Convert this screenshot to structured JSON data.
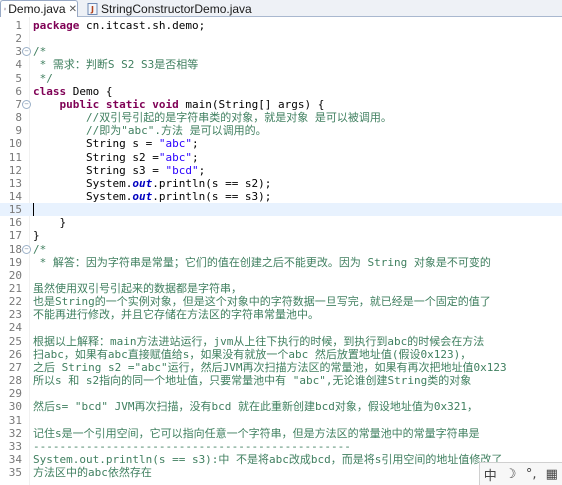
{
  "tabs": [
    {
      "label": "Demo.java",
      "active": true,
      "close": "✕"
    },
    {
      "label": "StringConstructorDemo.java",
      "active": false
    }
  ],
  "lines": [
    {
      "n": "1",
      "fold": false,
      "parts": [
        {
          "t": "package",
          "c": "kw"
        },
        {
          "t": " cn.itcast.sh.demo;",
          "c": ""
        }
      ]
    },
    {
      "n": "2",
      "fold": false,
      "parts": []
    },
    {
      "n": "3",
      "fold": true,
      "parts": [
        {
          "t": "/*",
          "c": "cm"
        }
      ]
    },
    {
      "n": "4",
      "fold": false,
      "parts": [
        {
          "t": " * 需求：判断S S2 S3是否相等",
          "c": "cm"
        }
      ]
    },
    {
      "n": "5",
      "fold": false,
      "parts": [
        {
          "t": " */",
          "c": "cm"
        }
      ]
    },
    {
      "n": "6",
      "fold": false,
      "parts": [
        {
          "t": "class",
          "c": "kw"
        },
        {
          "t": " Demo {",
          "c": ""
        }
      ]
    },
    {
      "n": "7",
      "fold": true,
      "parts": [
        {
          "t": "    ",
          "c": ""
        },
        {
          "t": "public static void",
          "c": "kw"
        },
        {
          "t": " main(String[] args) {",
          "c": ""
        }
      ]
    },
    {
      "n": "8",
      "fold": false,
      "parts": [
        {
          "t": "        //双引号引起的是字符串类的对象，就是对象 是可以被调用。",
          "c": "cm"
        }
      ]
    },
    {
      "n": "9",
      "fold": false,
      "parts": [
        {
          "t": "        //即为\"abc\".方法 是可以调用的。",
          "c": "cm"
        }
      ]
    },
    {
      "n": "10",
      "fold": false,
      "parts": [
        {
          "t": "        String s = ",
          "c": ""
        },
        {
          "t": "\"abc\"",
          "c": "str"
        },
        {
          "t": ";",
          "c": ""
        }
      ]
    },
    {
      "n": "11",
      "fold": false,
      "parts": [
        {
          "t": "        String s2 =",
          "c": ""
        },
        {
          "t": "\"abc\"",
          "c": "str"
        },
        {
          "t": ";",
          "c": ""
        }
      ]
    },
    {
      "n": "12",
      "fold": false,
      "parts": [
        {
          "t": "        String s3 = ",
          "c": ""
        },
        {
          "t": "\"bcd\"",
          "c": "str"
        },
        {
          "t": ";",
          "c": ""
        }
      ]
    },
    {
      "n": "13",
      "fold": false,
      "parts": [
        {
          "t": "        System.",
          "c": ""
        },
        {
          "t": "out",
          "c": "fld"
        },
        {
          "t": ".println(s == s2);",
          "c": ""
        }
      ]
    },
    {
      "n": "14",
      "fold": false,
      "parts": [
        {
          "t": "        System.",
          "c": ""
        },
        {
          "t": "out",
          "c": "fld"
        },
        {
          "t": ".println(s == s3);",
          "c": ""
        }
      ]
    },
    {
      "n": "15",
      "fold": false,
      "highlight": true,
      "parts": []
    },
    {
      "n": "16",
      "fold": false,
      "parts": [
        {
          "t": "    }",
          "c": ""
        }
      ]
    },
    {
      "n": "17",
      "fold": false,
      "parts": [
        {
          "t": "}",
          "c": ""
        }
      ]
    },
    {
      "n": "18",
      "fold": true,
      "parts": [
        {
          "t": "/*",
          "c": "cm"
        }
      ]
    },
    {
      "n": "19",
      "fold": false,
      "parts": [
        {
          "t": " * 解答：因为字符串是常量；它们的值在创建之后不能更改。因为 String 对象是不可变的",
          "c": "cm"
        }
      ]
    },
    {
      "n": "20",
      "fold": false,
      "parts": [
        {
          "t": "",
          "c": "cm"
        }
      ]
    },
    {
      "n": "21",
      "fold": false,
      "parts": [
        {
          "t": "虽然使用双引号引起来的数据都是字符串，",
          "c": "cm"
        }
      ]
    },
    {
      "n": "22",
      "fold": false,
      "parts": [
        {
          "t": "也是String的一个实例对象，但是这个对象中的字符数据一旦写完，就已经是一个固定的值了",
          "c": "cm"
        }
      ]
    },
    {
      "n": "23",
      "fold": false,
      "parts": [
        {
          "t": "不能再进行修改，并且它存储在方法区的字符串常量池中。",
          "c": "cm"
        }
      ]
    },
    {
      "n": "24",
      "fold": false,
      "parts": [
        {
          "t": "",
          "c": "cm"
        }
      ]
    },
    {
      "n": "25",
      "fold": false,
      "parts": [
        {
          "t": "根据以上解释：main方法进站运行，jvm从上往下执行的时候，到执行到abc的时候会在方法",
          "c": "cm"
        }
      ]
    },
    {
      "n": "26",
      "fold": false,
      "parts": [
        {
          "t": "扫abc，如果有abc直接赋值给s，如果没有就放一个abc 然后放置地址值(假设0x123)，",
          "c": "cm"
        }
      ]
    },
    {
      "n": "27",
      "fold": false,
      "parts": [
        {
          "t": "之后 String s2 =\"abc\"运行，然后JVM再次扫描方法区的常量池，如果有再次把地址值0x123",
          "c": "cm"
        }
      ]
    },
    {
      "n": "28",
      "fold": false,
      "parts": [
        {
          "t": "所以s 和 s2指向的同一个地址值，只要常量池中有 \"abc\",无论谁创建String类的对象",
          "c": "cm"
        }
      ]
    },
    {
      "n": "29",
      "fold": false,
      "parts": [
        {
          "t": "",
          "c": "cm"
        }
      ]
    },
    {
      "n": "30",
      "fold": false,
      "parts": [
        {
          "t": "然后s= \"bcd\" JVM再次扫描，没有bcd 就在此重新创建bcd对象，假设地址值为0x321，",
          "c": "cm"
        }
      ]
    },
    {
      "n": "31",
      "fold": false,
      "parts": [
        {
          "t": "",
          "c": "cm"
        }
      ]
    },
    {
      "n": "32",
      "fold": false,
      "parts": [
        {
          "t": "记住s是一个引用空间，它可以指向任意一个字符串，但是方法区的常量池中的常量字符串是",
          "c": "cm"
        }
      ]
    },
    {
      "n": "33",
      "fold": false,
      "parts": [
        {
          "t": "------------------------------------------------",
          "c": "cm"
        }
      ]
    },
    {
      "n": "34",
      "fold": false,
      "parts": [
        {
          "t": "System.out.println(s == s3):中 不是将abc改成bcd，而是将s引用空间的地址值修改了",
          "c": "cm"
        }
      ]
    },
    {
      "n": "35",
      "fold": false,
      "parts": [
        {
          "t": "方法区中的abc依然存在",
          "c": "cm"
        }
      ]
    }
  ],
  "ime": {
    "lang": "中",
    "moon": "☽",
    "dot": "°,",
    "mode": "▦"
  }
}
